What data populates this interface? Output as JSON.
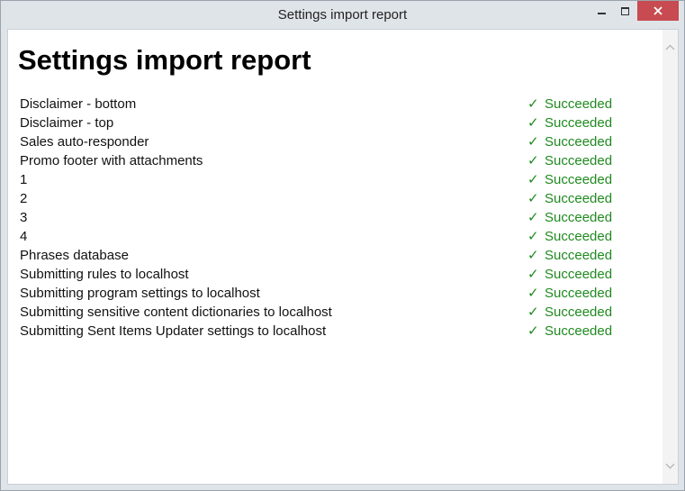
{
  "window": {
    "title": "Settings import report",
    "colors": {
      "close_button": "#c74b50",
      "success_text": "#1f8a1f"
    }
  },
  "report": {
    "heading": "Settings import report",
    "status_icon": "check-mark-icon",
    "items": [
      {
        "label": "Disclaimer - bottom",
        "status": "Succeeded"
      },
      {
        "label": "Disclaimer - top",
        "status": "Succeeded"
      },
      {
        "label": "Sales auto-responder",
        "status": "Succeeded"
      },
      {
        "label": "Promo footer with attachments",
        "status": "Succeeded"
      },
      {
        "label": "1",
        "status": "Succeeded"
      },
      {
        "label": "2",
        "status": "Succeeded"
      },
      {
        "label": "3",
        "status": "Succeeded"
      },
      {
        "label": "4",
        "status": "Succeeded"
      },
      {
        "label": "Phrases database",
        "status": "Succeeded"
      },
      {
        "label": "Submitting rules to localhost",
        "status": "Succeeded"
      },
      {
        "label": "Submitting program settings to localhost",
        "status": "Succeeded"
      },
      {
        "label": "Submitting sensitive content dictionaries to localhost",
        "status": "Succeeded"
      },
      {
        "label": "Submitting Sent Items Updater settings to localhost",
        "status": "Succeeded"
      }
    ]
  }
}
